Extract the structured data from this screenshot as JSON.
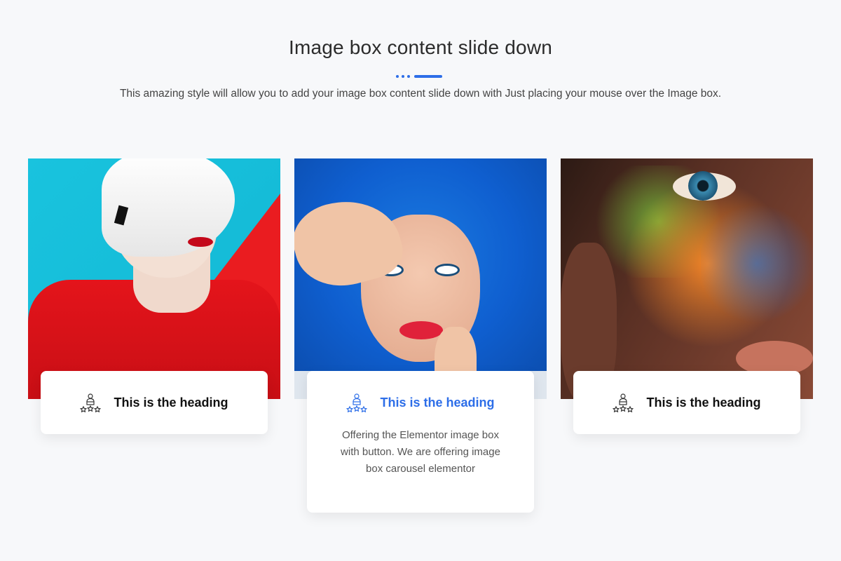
{
  "header": {
    "title": "Image box content slide down",
    "subtitle": "This amazing style will allow you to add your image box content slide down with Just placing your mouse over the Image box."
  },
  "colors": {
    "accent": "#2d6ee8",
    "background": "#f7f8fa"
  },
  "cards": [
    {
      "heading": "This is the heading",
      "icon": "team-award-icon",
      "active": false,
      "image": "woman-white-hair-red-sweater"
    },
    {
      "heading": "This is the heading",
      "icon": "team-award-icon",
      "active": true,
      "image": "woman-blue-curly-wig",
      "description": "Offering the Elementor image box with button. We are offering image box carousel elementor"
    },
    {
      "heading": "This is the heading",
      "icon": "team-award-icon",
      "active": false,
      "image": "woman-colorful-powder-face"
    }
  ]
}
